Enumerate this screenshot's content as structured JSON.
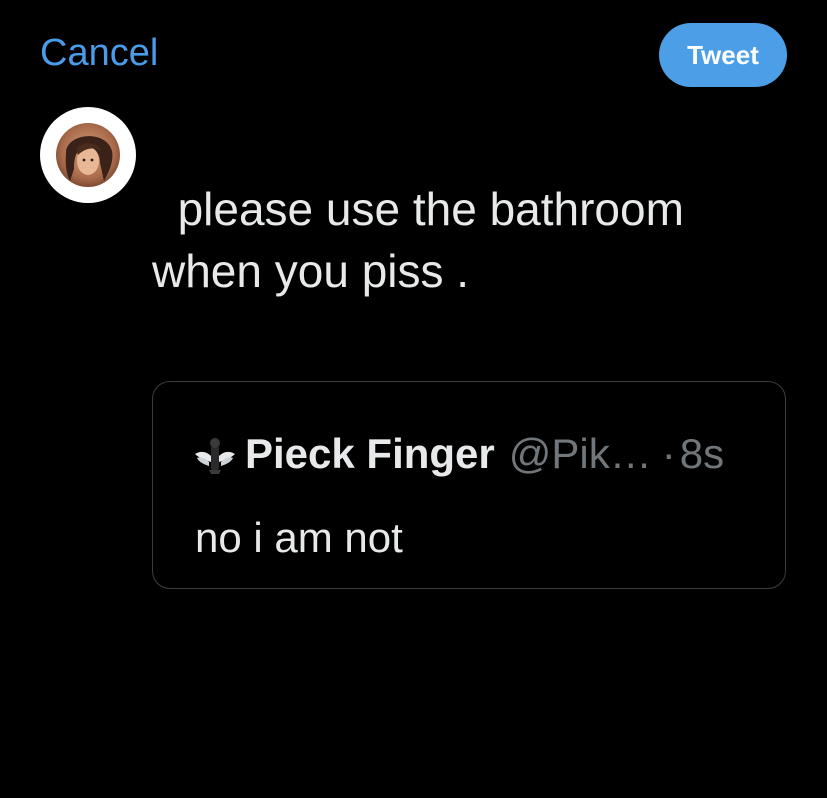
{
  "header": {
    "cancel_label": "Cancel",
    "tweet_label": "Tweet"
  },
  "composer": {
    "avatar_icon": "user-avatar-icon",
    "text_line1": "  please use the bathroom",
    "text_line2": "when you piss ."
  },
  "quoted_tweet": {
    "avatar_icon": "quoted-user-avatar-icon",
    "display_name": "Pieck Finger",
    "handle": "@Pik…",
    "separator": "·",
    "time": "8s",
    "text": "no i am not"
  },
  "colors": {
    "accent": "#4c9fe6",
    "link": "#4a9be8",
    "background": "#000000",
    "text": "#e7e9ea",
    "muted": "#71767b",
    "border": "#3a3d40"
  }
}
